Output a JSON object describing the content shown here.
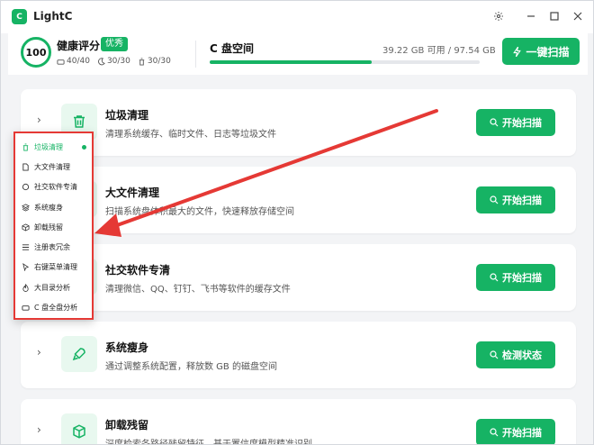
{
  "app": {
    "logo_text": "C",
    "title": "LightC"
  },
  "header": {
    "score": "100",
    "health_title": "健康评分",
    "badge": "优秀",
    "stats": [
      "40/40",
      "30/30",
      "30/30"
    ],
    "disk_title": "C 盘空间",
    "disk_info": "39.22 GB 可用 / 97.54 GB",
    "disk_used_fraction": 0.6,
    "scan_all_label": "一键扫描"
  },
  "cards": [
    {
      "title": "垃圾清理",
      "desc": "清理系统缓存、临时文件、日志等垃圾文件",
      "button": "开始扫描",
      "icon": "trash-icon"
    },
    {
      "title": "大文件清理",
      "desc": "扫描系统盘体积最大的文件，快速释放存储空间",
      "button": "开始扫描",
      "icon": "file-icon"
    },
    {
      "title": "社交软件专清",
      "desc": "清理微信、QQ、钉钉、飞书等软件的缓存文件",
      "button": "开始扫描",
      "icon": "chat-icon"
    },
    {
      "title": "系统瘦身",
      "desc": "通过调整系统配置，释放数 GB 的磁盘空间",
      "button": "检测状态",
      "icon": "rocket-icon"
    },
    {
      "title": "卸载残留",
      "desc": "深度检索各路径残留特征，基于置信度模型精准识别",
      "button": "开始扫描",
      "icon": "package-icon"
    }
  ],
  "menu": [
    {
      "label": "垃圾清理",
      "icon": "trash-icon"
    },
    {
      "label": "大文件清理",
      "icon": "file-icon"
    },
    {
      "label": "社交软件专清",
      "icon": "chat-icon"
    },
    {
      "label": "系统瘦身",
      "icon": "layers-icon"
    },
    {
      "label": "卸载残留",
      "icon": "package-icon"
    },
    {
      "label": "注册表冗余",
      "icon": "list-icon"
    },
    {
      "label": "右键菜单清理",
      "icon": "cursor-icon"
    },
    {
      "label": "大目录分析",
      "icon": "flame-icon"
    },
    {
      "label": "C 盘全盘分析",
      "icon": "drive-icon"
    }
  ],
  "colors": {
    "accent": "#16b364",
    "highlight": "#e53935"
  }
}
